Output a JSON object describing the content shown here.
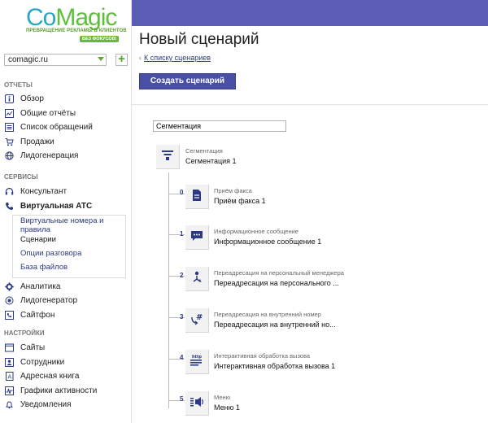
{
  "logo": {
    "text_co": "Co",
    "text_magic": "Magic",
    "tagline": "ПРЕВРАЩЕНИЕ РЕКЛАМЫ В КЛИЕНТОВ",
    "badge": "БЕЗ ФОКУСОВ!"
  },
  "site_select": {
    "value": "comagic.ru"
  },
  "sidebar": {
    "reports_head": "ОТЧЕТЫ",
    "reports": [
      {
        "label": "Обзор",
        "icon": "info-icon"
      },
      {
        "label": "Общие отчёты",
        "icon": "chart-icon"
      },
      {
        "label": "Список обращений",
        "icon": "list-icon"
      },
      {
        "label": "Продажи",
        "icon": "cart-icon"
      },
      {
        "label": "Лидогенерация",
        "icon": "globe-icon"
      }
    ],
    "services_head": "СЕРВИСЫ",
    "services": [
      {
        "label": "Консультант",
        "icon": "headset-icon"
      },
      {
        "label": "Виртуальная АТС",
        "icon": "phone-icon"
      }
    ],
    "submenu": [
      {
        "label": "Виртуальные номера и правила"
      },
      {
        "label": "Сценарии"
      },
      {
        "label": "Опции разговора"
      },
      {
        "label": "База файлов"
      }
    ],
    "services2": [
      {
        "label": "Аналитика",
        "icon": "gear-icon"
      },
      {
        "label": "Лидогенератор",
        "icon": "leadgen-icon"
      },
      {
        "label": "Сайтфон",
        "icon": "sitephone-icon"
      }
    ],
    "settings_head": "НАСТРОЙКИ",
    "settings": [
      {
        "label": "Сайты",
        "icon": "sites-icon"
      },
      {
        "label": "Сотрудники",
        "icon": "employees-icon"
      },
      {
        "label": "Адресная книга",
        "icon": "addressbook-icon"
      },
      {
        "label": "Графики активности",
        "icon": "activity-icon"
      },
      {
        "label": "Уведомления",
        "icon": "bell-icon"
      }
    ]
  },
  "main": {
    "title": "Новый сценарий",
    "back_link": "К списку сценариев",
    "create_button": "Создать сценарий",
    "segment_input_value": "Сегментация"
  },
  "tree": {
    "root": {
      "type": "Сегментация",
      "name": "Сегментация 1",
      "icon": "filter-icon"
    },
    "children": [
      {
        "num": "0",
        "type": "Приём факса",
        "name": "Приём факса 1",
        "icon": "fax-document-icon"
      },
      {
        "num": "1",
        "type": "Информационное сообщение",
        "name": "Информационное сообщение 1",
        "icon": "message-icon"
      },
      {
        "num": "2",
        "type": "Переадресация на персональный менеджера",
        "name": "Переадресация на персонального ...",
        "icon": "forward-person-icon"
      },
      {
        "num": "3",
        "type": "Переадресация на внутренний номер",
        "name": "Переадресация на внутренний но...",
        "icon": "forward-extension-icon"
      },
      {
        "num": "4",
        "type": "Интерактивная обработка вызова",
        "name": "Интерактивная обработка вызова 1",
        "icon": "http-icon"
      },
      {
        "num": "5",
        "type": "Меню",
        "name": "Меню 1",
        "icon": "menu-speaker-icon"
      }
    ]
  },
  "colors": {
    "topband": "#5a5cb6",
    "button": "#4a4fa6",
    "link": "#2b3a83",
    "accent_green": "#4fa32a"
  }
}
